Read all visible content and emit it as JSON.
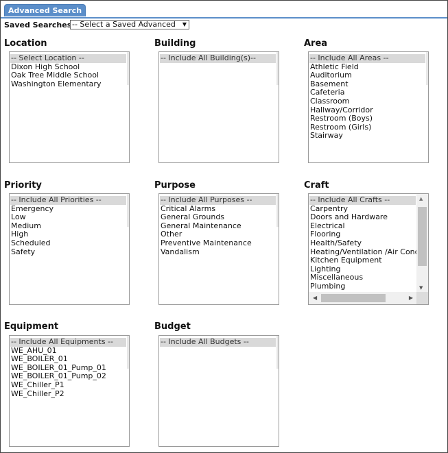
{
  "tab": {
    "label": "Advanced Search"
  },
  "saved_searches": {
    "label": "Saved Searches",
    "value": "-- Select a Saved Advanced"
  },
  "groups": {
    "location": {
      "title": "Location",
      "items": [
        "-- Select Location --",
        "Dixon High School",
        "Oak Tree Middle School",
        "Washington Elementary"
      ]
    },
    "building": {
      "title": "Building",
      "items": [
        "-- Include All Building(s)--"
      ]
    },
    "area": {
      "title": "Area",
      "items": [
        "-- Include All Areas --",
        "Athletic Field",
        "Auditorium",
        "Basement",
        "Cafeteria",
        "Classroom",
        "Hallway/Corridor",
        "Restroom (Boys)",
        "Restroom (Girls)",
        "Stairway"
      ]
    },
    "priority": {
      "title": "Priority",
      "items": [
        "-- Include All Priorities --",
        "Emergency",
        "Low",
        "Medium",
        "High",
        "Scheduled",
        "Safety"
      ]
    },
    "purpose": {
      "title": "Purpose",
      "items": [
        "-- Include All Purposes --",
        "Critical Alarms",
        "General Grounds",
        "General Maintenance",
        "Other",
        "Preventive Maintenance",
        "Vandalism"
      ]
    },
    "craft": {
      "title": "Craft",
      "items": [
        "-- Include All Crafts --",
        "Carpentry",
        "Doors and Hardware",
        "Electrical",
        "Flooring",
        "Health/Safety",
        "Heating/Ventilation /Air Cond",
        "Kitchen Equipment",
        "Lighting",
        "Miscellaneous",
        "Plumbing"
      ]
    },
    "equipment": {
      "title": "Equipment",
      "items": [
        "-- Include All Equipments --",
        "WE_AHU_01",
        "WE_BOILER_01",
        "WE_BOILER_01_Pump_01",
        "WE_BOILER_01_Pump_02",
        "WE_Chiller_P1",
        "WE_Chiller_P2"
      ]
    },
    "budget": {
      "title": "Budget",
      "items": [
        "-- Include All Budgets --"
      ]
    }
  }
}
